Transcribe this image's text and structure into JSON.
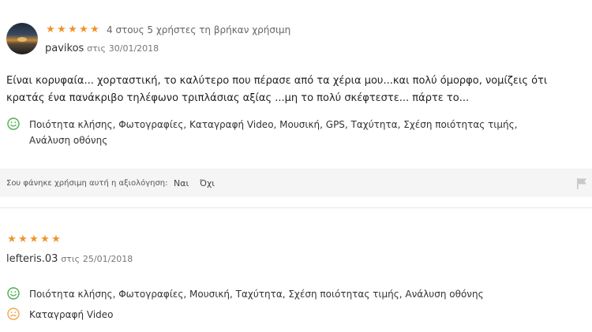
{
  "reviews": [
    {
      "rating": 5,
      "stars": "★★★★★",
      "helpful_count": "4 στους 5 χρήστες τη βρήκαν χρήσιμη",
      "author": "pavikos",
      "date_prefix": "στις",
      "date": "30/01/2018",
      "body": "Είναι κορυφαία... χορταστική, το καλύτερο που πέρασε από τα χέρια μου...και πολύ όμορφο, νομίζεις ότι κρατάς ένα πανάκριβο τηλέφωνο τριπλάσιας αξίας ...μη το πολύ σκέφτεστε... πάρτε το...",
      "pros_line1": "Ποιότητα κλήσης, Φωτογραφίες, Καταγραφή Video, Μουσική, GPS, Ταχύτητα, Σχέση ποιότητας τιμής,",
      "pros_line2": "Ανάλυση οθόνης"
    },
    {
      "rating": 5,
      "stars": "★★★★★",
      "author": "lefteris.03",
      "date_prefix": "στις",
      "date": "25/01/2018",
      "pros": "Ποιότητα κλήσης, Φωτογραφίες, Μουσική, Ταχύτητα, Σχέση ποιότητας τιμής, Ανάλυση οθόνης",
      "neutral": "Καταγραφή Video"
    }
  ],
  "helpful": {
    "question": "Σου φάνηκε χρήσιμη αυτή η αξιολόγηση:",
    "yes": "Ναι",
    "no": "Όχι"
  },
  "colors": {
    "star": "#f0932b",
    "positive": "#4caf50",
    "neutral": "#f0a64b"
  }
}
